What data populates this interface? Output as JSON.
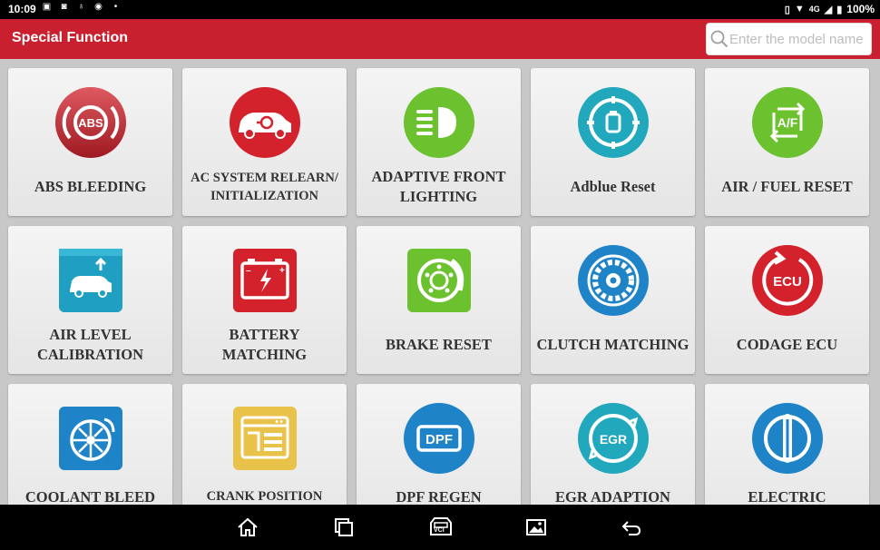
{
  "status_bar": {
    "time": "10:09",
    "network": "4G",
    "battery": "100%"
  },
  "header": {
    "title": "Special Function",
    "search_placeholder": "Enter the model name"
  },
  "colors": {
    "header_red": "#c8202f",
    "icon_red": "#d3222c",
    "icon_green": "#6cc12f",
    "icon_blue": "#1f83c8",
    "icon_teal": "#22a8bd",
    "icon_yellow": "#e9c24a"
  },
  "tiles": [
    {
      "label": "ABS BLEEDING",
      "icon": "abs-icon"
    },
    {
      "label": "AC SYSTEM RELEARN/ INITIALIZATION",
      "icon": "ac-system-icon"
    },
    {
      "label": "ADAPTIVE FRONT LIGHTING",
      "icon": "headlight-icon"
    },
    {
      "label": "Adblue Reset",
      "icon": "adblue-icon"
    },
    {
      "label": "AIR / FUEL RESET",
      "icon": "air-fuel-icon"
    },
    {
      "label": "AIR LEVEL CALIBRATION",
      "icon": "air-level-icon"
    },
    {
      "label": "BATTERY MATCHING",
      "icon": "battery-icon"
    },
    {
      "label": "BRAKE RESET",
      "icon": "brake-icon"
    },
    {
      "label": "CLUTCH MATCHING",
      "icon": "clutch-icon"
    },
    {
      "label": "CODAGE ECU",
      "icon": "ecu-icon"
    },
    {
      "label": "COOLANT BLEED",
      "icon": "coolant-icon"
    },
    {
      "label": "CRANK POSITION SENSOR ADAPTIVE",
      "icon": "crank-sensor-icon"
    },
    {
      "label": "DPF REGEN",
      "icon": "dpf-icon"
    },
    {
      "label": "EGR ADAPTION",
      "icon": "egr-icon"
    },
    {
      "label": "ELECTRIC THROTTLE",
      "icon": "throttle-icon"
    }
  ],
  "nav": {
    "vci_label": "VCI"
  }
}
